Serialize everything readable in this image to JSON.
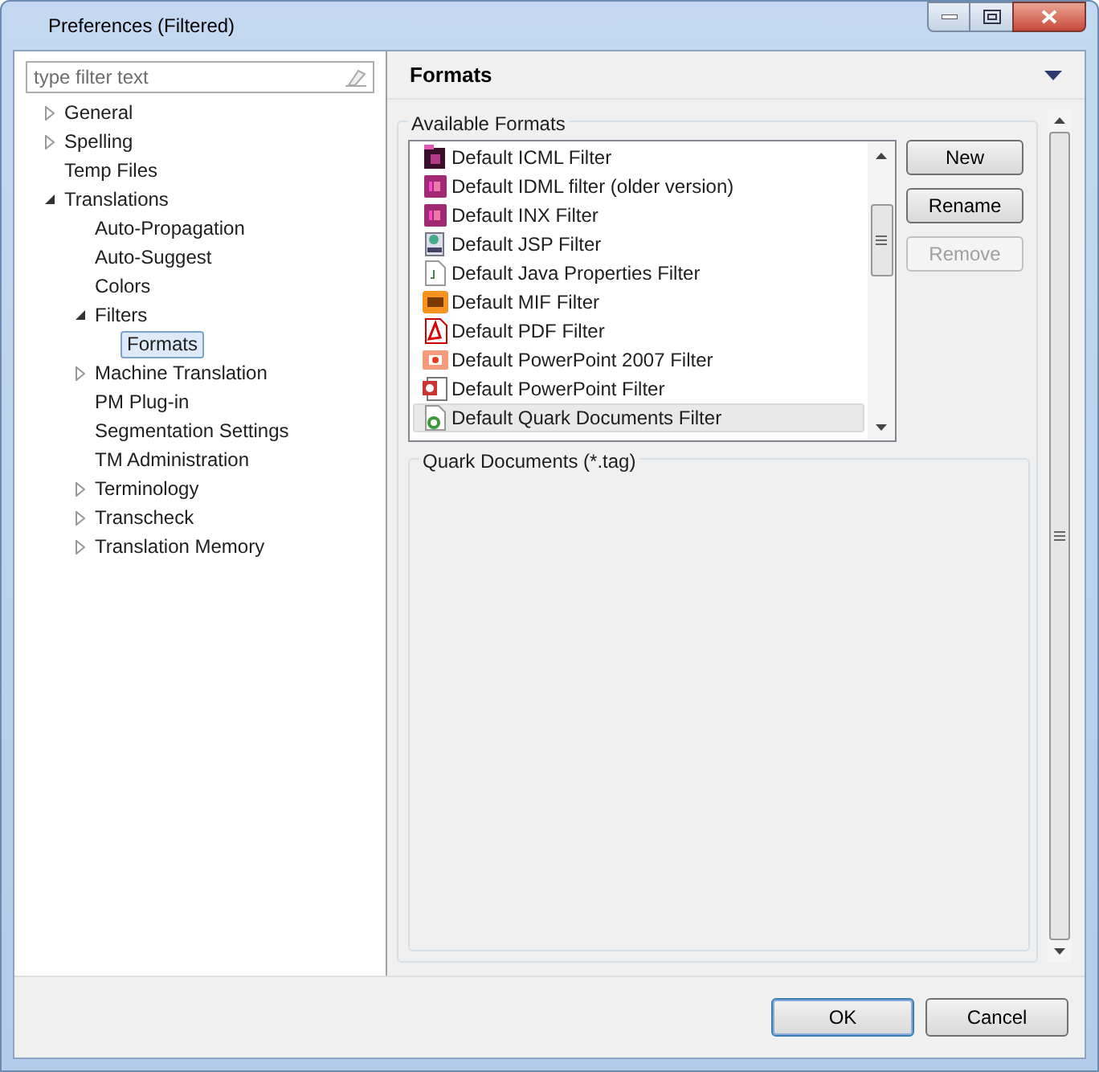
{
  "window": {
    "title": "Preferences (Filtered)"
  },
  "filter": {
    "placeholder": "type filter text"
  },
  "tree": [
    {
      "label": "General",
      "expanded": false,
      "selected": false
    },
    {
      "label": "Spelling",
      "expanded": false,
      "selected": false
    },
    {
      "label": "Temp Files",
      "selected": false
    },
    {
      "label": "Translations",
      "expanded": true,
      "selected": false,
      "children": [
        {
          "label": "Auto-Propagation",
          "selected": false
        },
        {
          "label": "Auto-Suggest",
          "selected": false
        },
        {
          "label": "Colors",
          "selected": false
        },
        {
          "label": "Filters",
          "expanded": true,
          "selected": false,
          "children": [
            {
              "label": "Formats",
              "selected": true
            }
          ]
        },
        {
          "label": "Machine Translation",
          "expanded": false,
          "selected": false
        },
        {
          "label": "PM Plug-in",
          "selected": false
        },
        {
          "label": "Segmentation Settings",
          "selected": false
        },
        {
          "label": "TM Administration",
          "selected": false
        },
        {
          "label": "Terminology",
          "expanded": false,
          "selected": false
        },
        {
          "label": "Transcheck",
          "expanded": false,
          "selected": false
        },
        {
          "label": "Translation Memory",
          "expanded": false,
          "selected": false
        }
      ]
    }
  ],
  "page": {
    "title": "Formats",
    "available_formats": {
      "label": "Available Formats",
      "items": [
        {
          "label": "Default ICML Filter",
          "kind": "indesign-dark",
          "selected": false
        },
        {
          "label": "Default IDML filter (older version)",
          "kind": "indesign",
          "selected": false
        },
        {
          "label": "Default INX Filter",
          "kind": "indesign",
          "selected": false
        },
        {
          "label": "Default JSP Filter",
          "kind": "jsp",
          "selected": false
        },
        {
          "label": "Default Java Properties Filter",
          "kind": "java",
          "selected": false
        },
        {
          "label": "Default MIF Filter",
          "kind": "framemaker",
          "selected": false
        },
        {
          "label": "Default PDF Filter",
          "kind": "pdf",
          "selected": false
        },
        {
          "label": "Default PowerPoint 2007 Filter",
          "kind": "ppt2007",
          "selected": false
        },
        {
          "label": "Default PowerPoint Filter",
          "kind": "ppt",
          "selected": false
        },
        {
          "label": "Default Quark Documents Filter",
          "kind": "quark",
          "selected": true
        }
      ],
      "buttons": [
        {
          "label": "New",
          "disabled": false
        },
        {
          "label": "Rename",
          "disabled": false
        },
        {
          "label": "Remove",
          "disabled": true
        }
      ]
    },
    "details": {
      "label": "Quark Documents (*.tag)"
    }
  },
  "buttons": [
    {
      "label": "OK",
      "default": true
    },
    {
      "label": "Cancel",
      "default": false
    }
  ]
}
